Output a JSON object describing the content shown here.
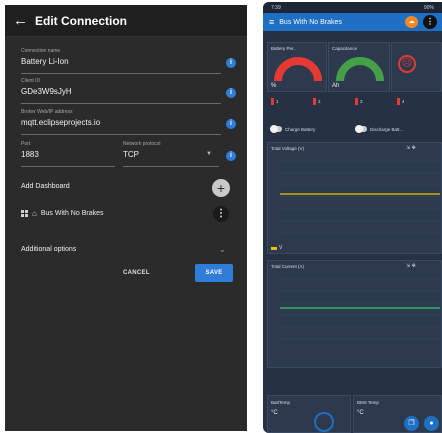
{
  "left": {
    "title": "Edit Connection",
    "fields": {
      "connection_name": {
        "label": "Connection name",
        "value": "Battery Li-Ion"
      },
      "client_id": {
        "label": "Client ID",
        "value": "GDe3W9sJyH"
      },
      "broker": {
        "label": "Broker Web/IP address",
        "value": "mqtt.eclipseprojects.io"
      },
      "port": {
        "label": "Port",
        "value": "1883"
      },
      "protocol": {
        "label": "Network protocol",
        "value": "TCP"
      }
    },
    "add_dashboard": "Add Dashboard",
    "dashboard_name": "Bus With No Brakes",
    "additional_options": "Additional options",
    "cancel": "CANCEL",
    "save": "SAVE"
  },
  "right": {
    "status_time": "7:39",
    "status_right": "90%",
    "title": "Bus With No Brakes",
    "gauges": [
      {
        "label": "Battery Per..",
        "unit": "%",
        "color": "#e53935"
      },
      {
        "label": "Capacitance",
        "unit": "Ah",
        "color": "#43a047"
      }
    ],
    "io": [
      "1",
      "2",
      "3",
      "4"
    ],
    "switches": [
      "Charge Battery",
      "Discharge Batt..."
    ],
    "voltage_chart": {
      "title": "Total Voltage (V)",
      "legend": "V"
    },
    "current_chart": {
      "title": "Total Current (A)"
    },
    "temps": [
      {
        "label": "BattTemp",
        "unit": "°C"
      },
      {
        "label": "BMS Temp",
        "unit": "°C"
      }
    ],
    "colors": {
      "appbar": "#1f6fc4",
      "background": "#263244",
      "voltage_line": "#f2c200",
      "current_line": "#2ecc71"
    }
  }
}
